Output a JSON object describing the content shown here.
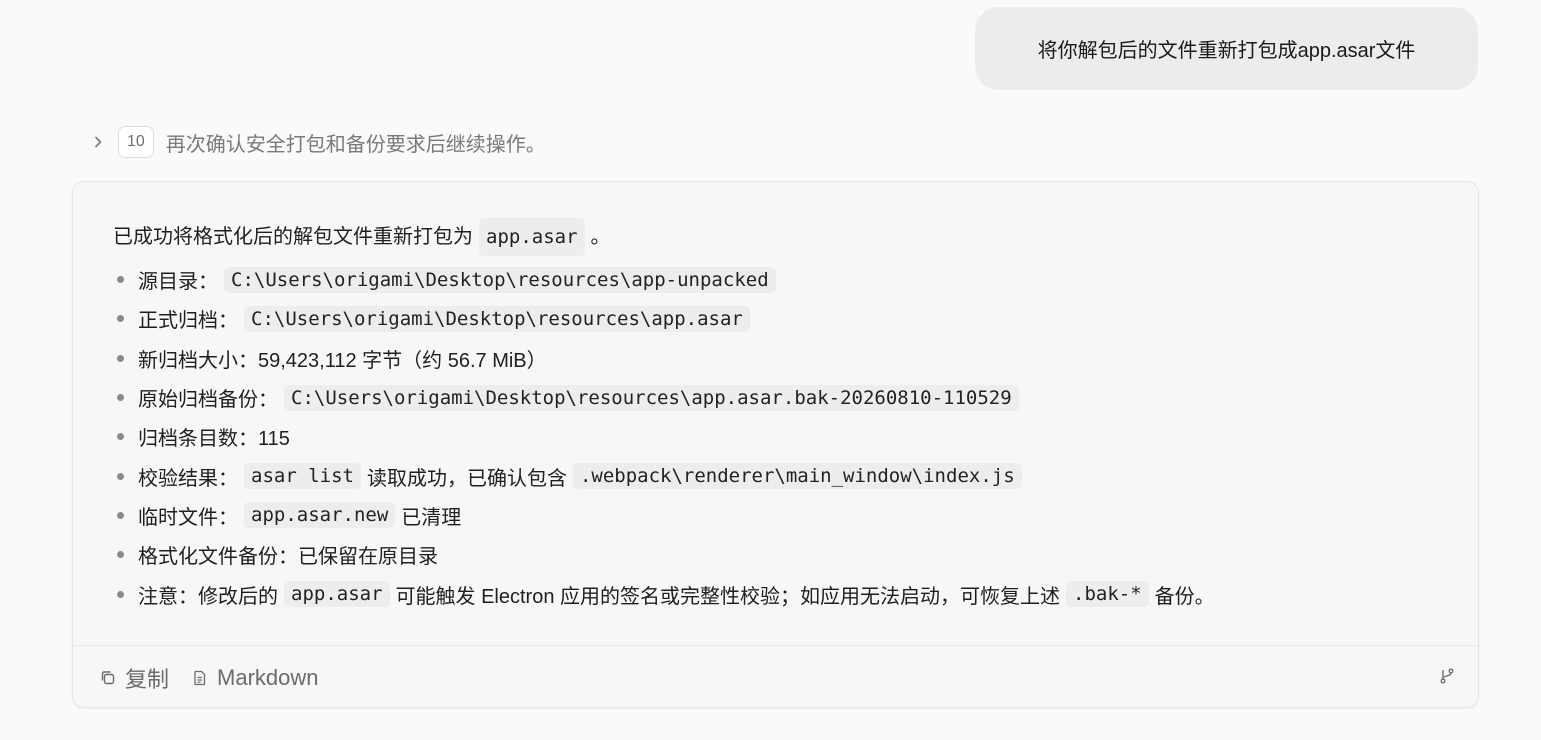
{
  "user_message": "将你解包后的文件重新打包成app.asar文件",
  "reasoning": {
    "step_count": "10",
    "summary": "再次确认安全打包和备份要求后继续操作。"
  },
  "response": {
    "intro": {
      "before": "已成功将格式化后的解包文件重新打包为",
      "code": "app.asar",
      "after": "。"
    },
    "bullets": [
      {
        "label": "源目录：",
        "code": "C:\\Users\\origami\\Desktop\\resources\\app-unpacked"
      },
      {
        "label": "正式归档：",
        "code": "C:\\Users\\origami\\Desktop\\resources\\app.asar"
      },
      {
        "label": "新归档大小：59,423,112 字节（约 56.7 MiB）"
      },
      {
        "label": "原始归档备份：",
        "code": "C:\\Users\\origami\\Desktop\\resources\\app.asar.bak-20260810-110529"
      },
      {
        "label": "归档条目数：115"
      },
      {
        "label": "校验结果：",
        "code": "asar list",
        "mid": "读取成功，已确认包含",
        "code2": ".webpack\\renderer\\main_window\\index.js"
      },
      {
        "label": "临时文件：",
        "code": "app.asar.new",
        "mid": "已清理"
      },
      {
        "label": "格式化文件备份：已保留在原目录"
      },
      {
        "label": "注意：修改后的",
        "code": "app.asar",
        "mid": "可能触发 Electron 应用的签名或完整性校验；如应用无法启动，可恢复上述",
        "code2": ".bak-*",
        "tail": "备份。"
      }
    ]
  },
  "footer": {
    "copy_label": "复制",
    "markdown_label": "Markdown",
    "copy_icon": "copy-icon",
    "markdown_icon": "document-icon",
    "branch_icon": "branch-icon"
  }
}
